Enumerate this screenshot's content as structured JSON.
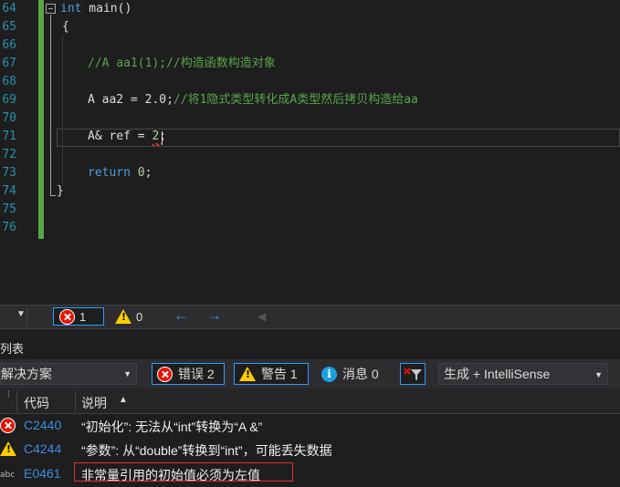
{
  "editor": {
    "line_numbers": [
      "64",
      "65",
      "66",
      "67",
      "68",
      "69",
      "70",
      "71",
      "72",
      "73",
      "74",
      "75",
      "76"
    ],
    "lines": {
      "l64_kw": "int",
      "l64_rest": " main()",
      "l65": "{",
      "l67": "//A aa1(1);//构造函数构造对象",
      "l69_code": "A aa2 = 2.0;",
      "l69_cmt": "//将1隐式类型转化成A类型然后拷贝构造给aa",
      "l71_code": "A& ref = ",
      "l71_num": "2",
      "l71_end": ";",
      "l73_kw": "return",
      "l73_num": " 0",
      "l73_end": ";",
      "l74": "}"
    }
  },
  "status_strip": {
    "error_count": "1",
    "warning_count": "0",
    "back_arrow": "←",
    "forward_arrow": "→"
  },
  "error_list": {
    "title": "列表",
    "scope": "解决方案",
    "errors_label": "错误 2",
    "warnings_label": "警告 1",
    "messages_label": "消息 0",
    "build_filter": "生成 + IntelliSense",
    "columns": {
      "code": "代码",
      "description": "说明"
    },
    "rows": [
      {
        "icon": "error-icon",
        "code": "C2440",
        "description": "“初始化”: 无法从“int”转换为“A &”"
      },
      {
        "icon": "warning-icon",
        "code": "C4244",
        "description": "“参数”: 从“double”转换到“int”，可能丢失数据"
      },
      {
        "icon": "intellisense-icon",
        "code": "E0461",
        "description": "非常量引用的初始值必须为左值"
      }
    ]
  },
  "colors": {
    "accent": "#3399ff",
    "error": "#e51400",
    "warning": "#ffcc00",
    "code_link": "#3b8de0"
  }
}
